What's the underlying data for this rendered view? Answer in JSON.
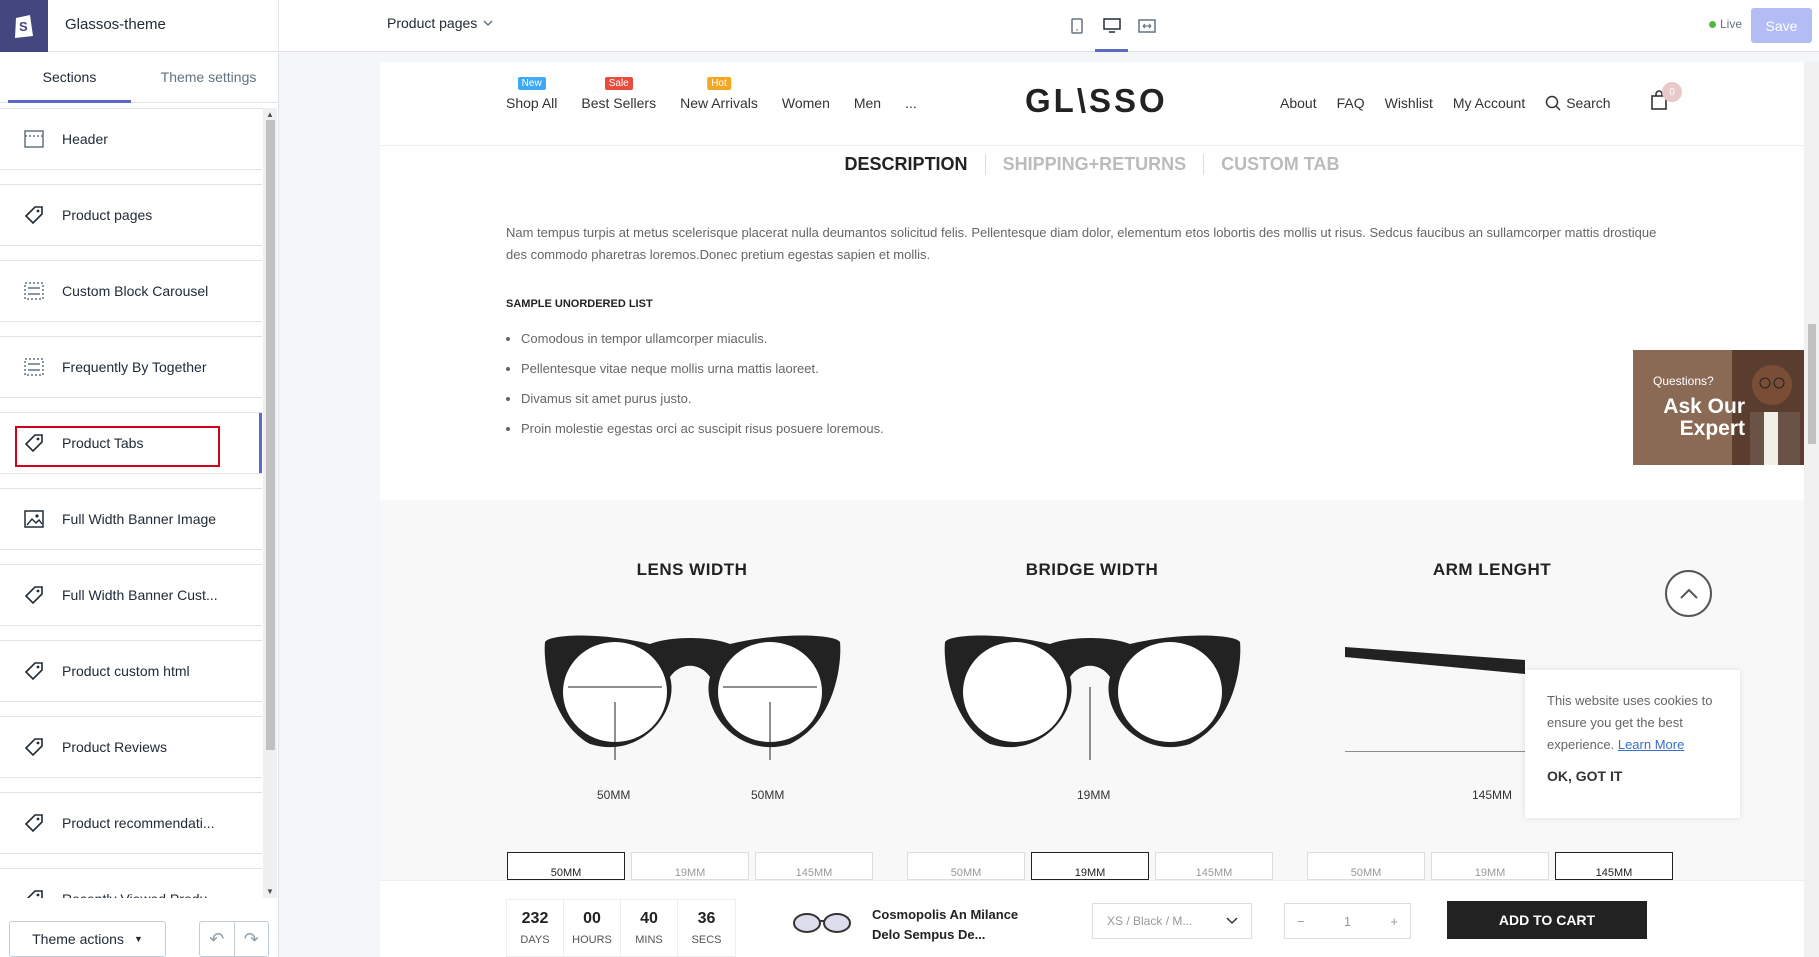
{
  "editor": {
    "theme_name": "Glassos-theme",
    "page_select": "Product pages",
    "live": "Live",
    "save": "Save"
  },
  "sidebar": {
    "tabs": [
      "Sections",
      "Theme settings"
    ],
    "sections": [
      {
        "label": "Header",
        "icon": "header-icon"
      },
      {
        "label": "Product pages",
        "icon": "tag-icon"
      },
      {
        "label": "Custom Block Carousel",
        "icon": "section-icon"
      },
      {
        "label": "Frequently By Together",
        "icon": "section-icon"
      },
      {
        "label": "Product Tabs",
        "icon": "tag-icon"
      },
      {
        "label": "Full Width Banner Image",
        "icon": "image-icon"
      },
      {
        "label": "Full Width Banner Cust...",
        "icon": "tag-icon"
      },
      {
        "label": "Product custom html",
        "icon": "tag-icon"
      },
      {
        "label": "Product Reviews",
        "icon": "tag-icon"
      },
      {
        "label": "Product recommendati...",
        "icon": "tag-icon"
      },
      {
        "label": "Recently Viewed Produ...",
        "icon": "tag-icon"
      }
    ],
    "theme_actions": "Theme actions"
  },
  "store": {
    "nav_left": [
      {
        "label": "Shop All",
        "badge": "New",
        "badge_color": "#3fa9f5"
      },
      {
        "label": "Best Sellers",
        "badge": "Sale",
        "badge_color": "#e74c3c"
      },
      {
        "label": "New Arrivals",
        "badge": "Hot",
        "badge_color": "#f5a623"
      },
      {
        "label": "Women",
        "badge": "",
        "badge_color": ""
      },
      {
        "label": "Men",
        "badge": "",
        "badge_color": ""
      },
      {
        "label": "...",
        "badge": "",
        "badge_color": ""
      }
    ],
    "brand": "GL\\SSO",
    "nav_right": [
      "About",
      "FAQ",
      "Wishlist",
      "My Account",
      "Search"
    ],
    "cart_count": "0"
  },
  "tabs": [
    "DESCRIPTION",
    "SHIPPING+RETURNS",
    "CUSTOM TAB"
  ],
  "description": {
    "paragraph": "Nam tempus turpis at metus scelerisque placerat nulla deumantos solicitud felis. Pellentesque diam dolor, elementum etos lobortis des mollis ut risus. Sedcus faucibus an sullamcorper mattis drostique des commodo pharetras loremos.Donec pretium egestas sapien et mollis.",
    "list_title": "SAMPLE UNORDERED LIST",
    "list": [
      "Comodous in tempor ullamcorper miaculis.",
      "Pellentesque vitae neque mollis urna mattis laoreet.",
      "Divamus sit amet purus justo.",
      "Proin molestie egestas orci ac suscipit risus posuere loremous."
    ]
  },
  "expert": {
    "question": "Questions?",
    "title": "Ask Our Expert"
  },
  "sizes": {
    "lens": {
      "title": "LENS WIDTH",
      "m1": "50MM",
      "m2": "50MM"
    },
    "bridge": {
      "title": "BRIDGE WIDTH",
      "m1": "19MM"
    },
    "arm": {
      "title": "ARM LENGHT",
      "m1": "145MM"
    },
    "boxes": [
      "50MM",
      "19MM",
      "145MM"
    ]
  },
  "cookie": {
    "text": "This website uses cookies to ensure you get the best experience.",
    "link": "Learn More",
    "ok": "OK, GOT IT"
  },
  "sticky": {
    "countdown": [
      {
        "n": "232",
        "u": "DAYS"
      },
      {
        "n": "00",
        "u": "HOURS"
      },
      {
        "n": "40",
        "u": "MINS"
      },
      {
        "n": "36",
        "u": "SECS"
      }
    ],
    "product_title": "Cosmopolis An Milance Delo Sempus De...",
    "variant": "XS / Black / M...",
    "qty": "1",
    "add_to_cart": "ADD TO CART"
  }
}
